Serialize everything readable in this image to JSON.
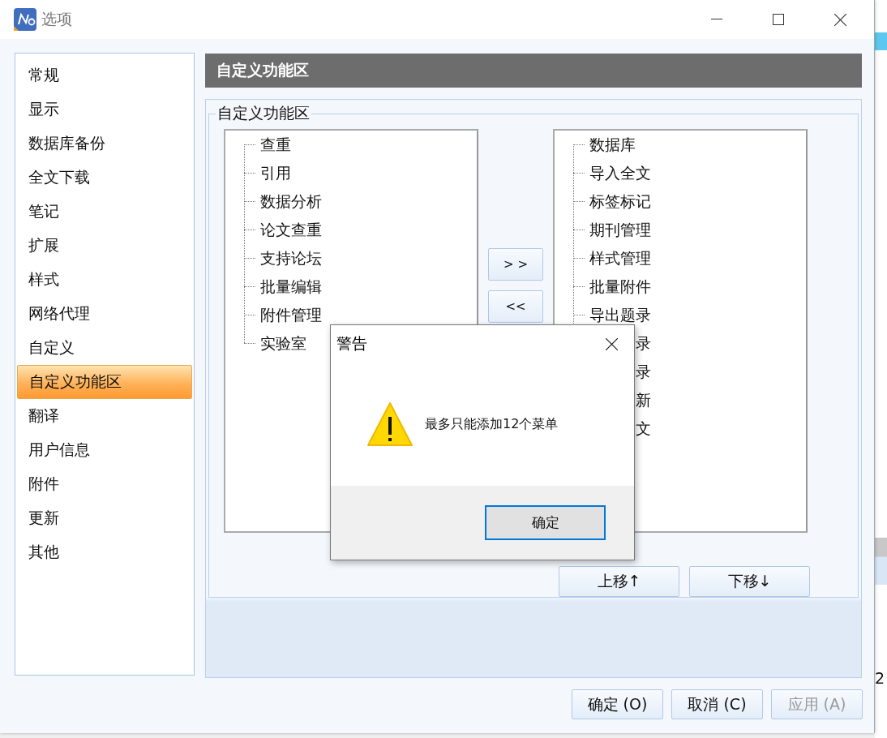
{
  "window": {
    "title": "选项"
  },
  "sidebar": {
    "items": [
      {
        "label": "常规",
        "selected": false
      },
      {
        "label": "显示",
        "selected": false
      },
      {
        "label": "数据库备份",
        "selected": false
      },
      {
        "label": "全文下载",
        "selected": false
      },
      {
        "label": "笔记",
        "selected": false
      },
      {
        "label": "扩展",
        "selected": false
      },
      {
        "label": "样式",
        "selected": false
      },
      {
        "label": "网络代理",
        "selected": false
      },
      {
        "label": "自定义",
        "selected": false
      },
      {
        "label": "自定义功能区",
        "selected": true
      },
      {
        "label": "翻译",
        "selected": false
      },
      {
        "label": "用户信息",
        "selected": false
      },
      {
        "label": "附件",
        "selected": false
      },
      {
        "label": "更新",
        "selected": false
      },
      {
        "label": "其他",
        "selected": false
      }
    ]
  },
  "section_header": "自定义功能区",
  "group": {
    "legend": "自定义功能区",
    "available_items": [
      "查重",
      "引用",
      "数据分析",
      "论文查重",
      "支持论坛",
      "批量编辑",
      "附件管理",
      "实验室"
    ],
    "add_button": "> >",
    "remove_button": "<<",
    "chosen_items": [
      "数据库",
      "导入全文",
      "标签标记",
      "期刊管理",
      "样式管理",
      "批量附件",
      "导出题录",
      "录",
      "录",
      "新",
      "文"
    ],
    "move_up_button": "上移↑",
    "move_down_button": "下移↓"
  },
  "footer_buttons": [
    {
      "label": "确定 (O)",
      "disabled": false
    },
    {
      "label": "取消 (C)",
      "disabled": false
    },
    {
      "label": "应用 (A)",
      "disabled": true
    }
  ],
  "dialog": {
    "title": "警告",
    "message": "最多只能添加12个菜单",
    "button": "确定"
  },
  "background_window": {
    "texts": [
      "2"
    ]
  }
}
